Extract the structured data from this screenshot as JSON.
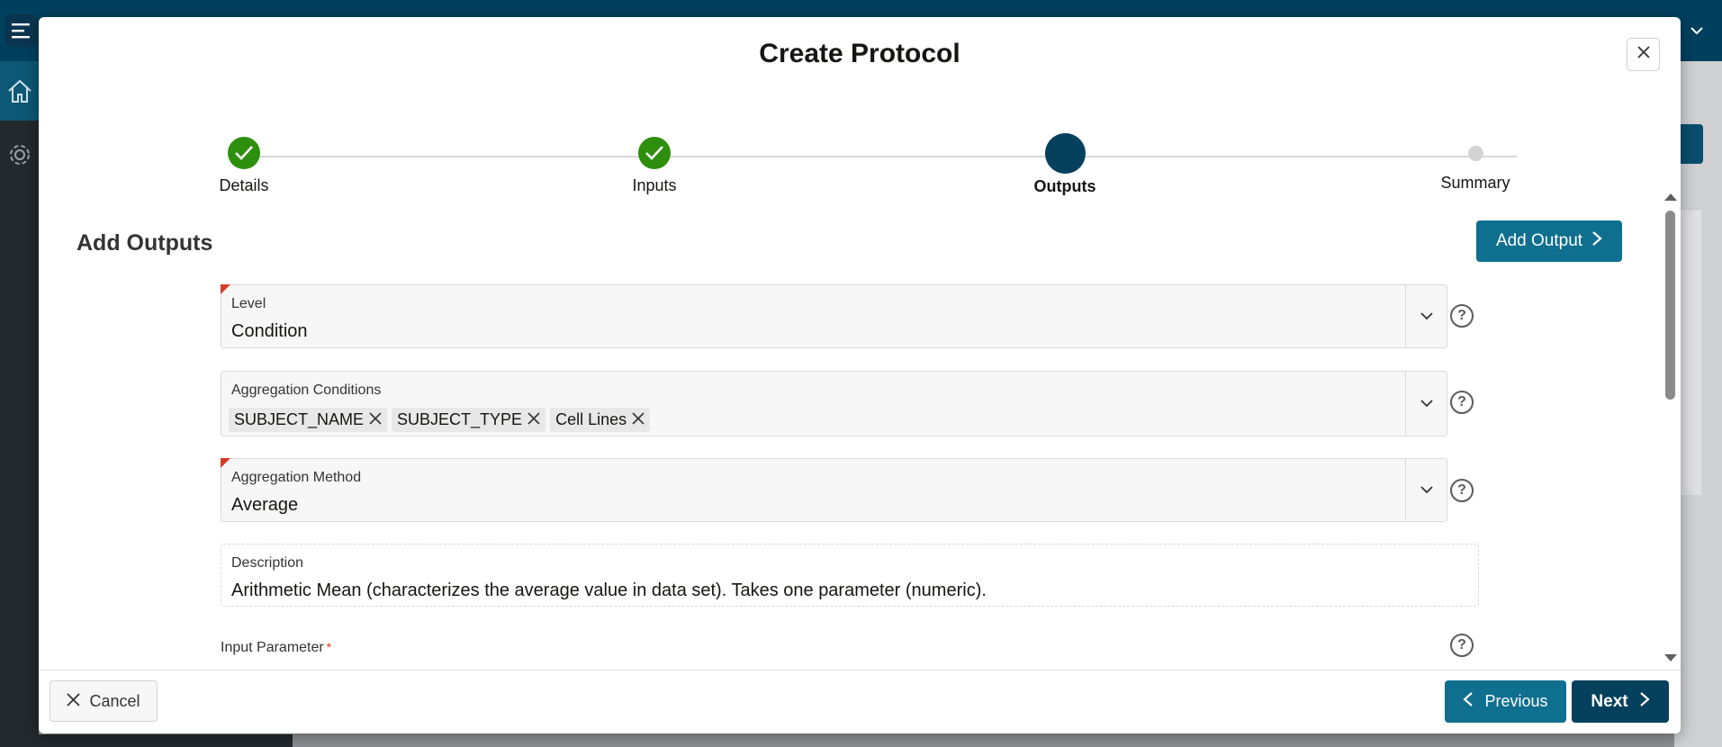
{
  "modal": {
    "title": "Create Protocol"
  },
  "stepper": {
    "steps": [
      {
        "label": "Details",
        "state": "done"
      },
      {
        "label": "Inputs",
        "state": "done"
      },
      {
        "label": "Outputs",
        "state": "current"
      },
      {
        "label": "Summary",
        "state": "todo"
      }
    ]
  },
  "section": {
    "title": "Add Outputs",
    "add_output_label": "Add Output"
  },
  "fields": {
    "level": {
      "label": "Level",
      "value": "Condition",
      "required": true
    },
    "aggregation_conditions": {
      "label": "Aggregation Conditions",
      "chips": [
        "SUBJECT_NAME",
        "SUBJECT_TYPE",
        "Cell Lines"
      ]
    },
    "aggregation_method": {
      "label": "Aggregation Method",
      "value": "Average",
      "required": true
    },
    "description": {
      "label": "Description",
      "value": "Arithmetic Mean (characterizes the average value in data set). Takes one parameter (numeric)."
    },
    "input_parameter": {
      "label": "Input Parameter",
      "required_mark": "*"
    }
  },
  "footer": {
    "cancel_label": "Cancel",
    "previous_label": "Previous",
    "next_label": "Next"
  },
  "colors": {
    "header": "#00405f",
    "done_step": "#2e8e0d",
    "current_step": "#05405d",
    "primary_button": "#0f6f8f",
    "next_button": "#05405d",
    "required_flag": "#d63b25"
  },
  "icons": {
    "close": "close-icon",
    "chevron_down": "chevron-down-icon",
    "help": "help-icon",
    "check": "check-icon",
    "chevron_right": "chevron-right-icon",
    "chevron_left": "chevron-left-icon"
  }
}
